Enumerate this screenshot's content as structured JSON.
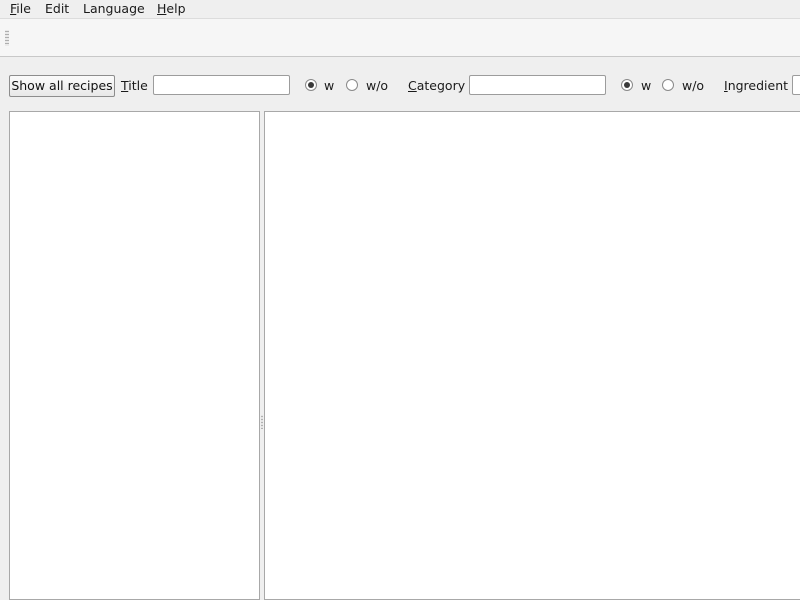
{
  "menubar": {
    "items": [
      {
        "mnemonic": "F",
        "rest": "ile"
      },
      {
        "mnemonic": "",
        "rest": "Edit"
      },
      {
        "mnemonic": "",
        "rest": "Language"
      },
      {
        "mnemonic": "H",
        "rest": "elp"
      }
    ]
  },
  "filters": {
    "show_all_label": "Show all recipes",
    "title": {
      "mnemonic": "T",
      "rest": "itle",
      "value": "",
      "with_label": "w",
      "without_label": "w/o",
      "selected": "w"
    },
    "category": {
      "mnemonic": "C",
      "rest": "ategory",
      "value": "",
      "with_label": "w",
      "without_label": "w/o",
      "selected": "w"
    },
    "ingredient": {
      "mnemonic": "I",
      "rest": "ngredient",
      "value": ""
    }
  },
  "recipe_list": {
    "items": []
  },
  "recipe_view": {
    "content": ""
  }
}
